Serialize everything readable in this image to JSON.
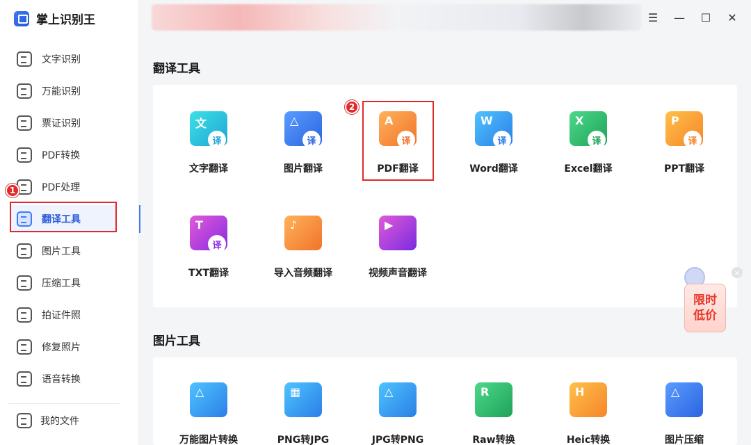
{
  "app": {
    "name": "掌上识别王"
  },
  "sidebar": {
    "items": [
      {
        "label": "文字识别",
        "icon": "text-recognition-icon"
      },
      {
        "label": "万能识别",
        "icon": "universal-recognition-icon"
      },
      {
        "label": "票证识别",
        "icon": "ticket-recognition-icon"
      },
      {
        "label": "PDF转换",
        "icon": "pdf-convert-icon"
      },
      {
        "label": "PDF处理",
        "icon": "pdf-process-icon"
      },
      {
        "label": "翻译工具",
        "icon": "translate-tools-icon",
        "active": true
      },
      {
        "label": "图片工具",
        "icon": "image-tools-icon"
      },
      {
        "label": "压缩工具",
        "icon": "compress-tools-icon"
      },
      {
        "label": "拍证件照",
        "icon": "id-photo-icon"
      },
      {
        "label": "修复照片",
        "icon": "photo-repair-icon"
      },
      {
        "label": "语音转换",
        "icon": "voice-convert-icon"
      }
    ],
    "footer": {
      "label": "我的文件",
      "icon": "my-files-icon"
    }
  },
  "markers": {
    "one": "1",
    "two": "2"
  },
  "window_controls": {
    "menu": "☰",
    "minimize": "—",
    "maximize": "☐",
    "close": "✕"
  },
  "sections": {
    "translate": {
      "title": "翻译工具",
      "tools": [
        {
          "label": "文字翻译",
          "glyph": "文",
          "color": "#22c3d6"
        },
        {
          "label": "图片翻译",
          "glyph": "△",
          "color": "#3d7cf5"
        },
        {
          "label": "PDF翻译",
          "glyph": "A",
          "color": "#f58a3a"
        },
        {
          "label": "Word翻译",
          "glyph": "W",
          "color": "#3b8df0"
        },
        {
          "label": "Excel翻译",
          "glyph": "X",
          "color": "#27b46a"
        },
        {
          "label": "PPT翻译",
          "glyph": "P",
          "color": "#f79a2a"
        },
        {
          "label": "TXT翻译",
          "glyph": "T",
          "color": "#b23bd8"
        },
        {
          "label": "导入音频翻译",
          "glyph": "♪",
          "color": "#f58a3a"
        },
        {
          "label": "视频声音翻译",
          "glyph": "▶",
          "color": "#b23bd8"
        }
      ],
      "badge_text": "译"
    },
    "image": {
      "title": "图片工具",
      "tools": [
        {
          "label": "万能图片转换",
          "glyph": "△",
          "color": "#2fa8ea"
        },
        {
          "label": "PNG转JPG",
          "glyph": "▦",
          "color": "#2fa8ea"
        },
        {
          "label": "JPG转PNG",
          "glyph": "△",
          "color": "#2fa8ea"
        },
        {
          "label": "Raw转换",
          "glyph": "R",
          "color": "#27b46a"
        },
        {
          "label": "Heic转换",
          "glyph": "H",
          "color": "#f58a3a"
        },
        {
          "label": "图片压缩",
          "glyph": "△",
          "color": "#3d7cf5"
        }
      ]
    }
  },
  "promo": {
    "text": "限时低价",
    "close": "×"
  }
}
